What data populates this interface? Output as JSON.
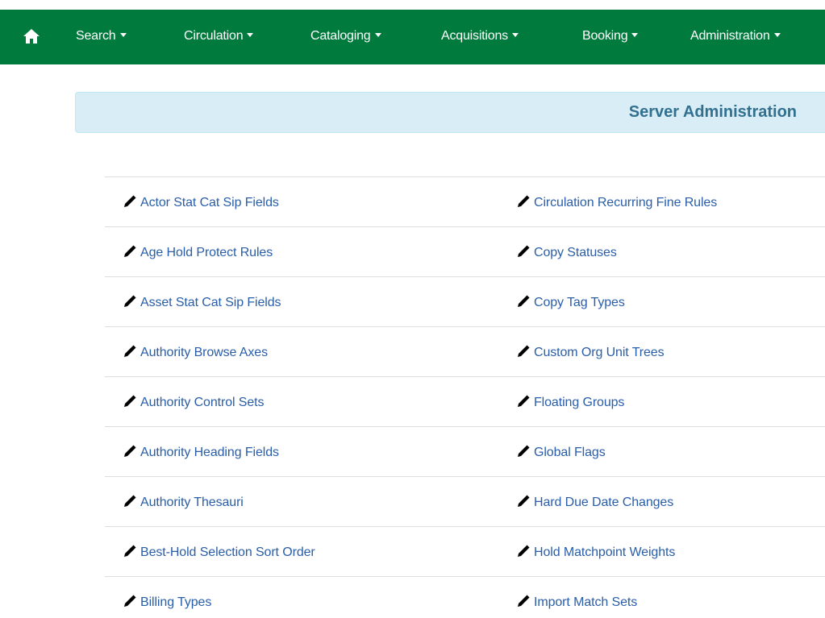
{
  "navbar": {
    "home_icon": "home-icon",
    "items": [
      {
        "label": "Search"
      },
      {
        "label": "Circulation"
      },
      {
        "label": "Cataloging"
      },
      {
        "label": "Acquisitions"
      },
      {
        "label": "Booking"
      },
      {
        "label": "Administration"
      }
    ],
    "background": "#007a3d"
  },
  "panel": {
    "title": "Server Administration",
    "background": "#d9edf7",
    "title_color": "#31708f"
  },
  "links": {
    "icon": "pencil-icon",
    "left": [
      {
        "label": "Actor Stat Cat Sip Fields"
      },
      {
        "label": "Age Hold Protect Rules"
      },
      {
        "label": "Asset Stat Cat Sip Fields"
      },
      {
        "label": "Authority Browse Axes"
      },
      {
        "label": "Authority Control Sets"
      },
      {
        "label": "Authority Heading Fields"
      },
      {
        "label": "Authority Thesauri"
      },
      {
        "label": "Best-Hold Selection Sort Order"
      },
      {
        "label": "Billing Types"
      }
    ],
    "right": [
      {
        "label": "Circulation Recurring Fine Rules"
      },
      {
        "label": "Copy Statuses"
      },
      {
        "label": "Copy Tag Types"
      },
      {
        "label": "Custom Org Unit Trees"
      },
      {
        "label": "Floating Groups"
      },
      {
        "label": "Global Flags"
      },
      {
        "label": "Hard Due Date Changes"
      },
      {
        "label": "Hold Matchpoint Weights"
      },
      {
        "label": "Import Match Sets"
      }
    ],
    "color": "#2a5ea8"
  }
}
